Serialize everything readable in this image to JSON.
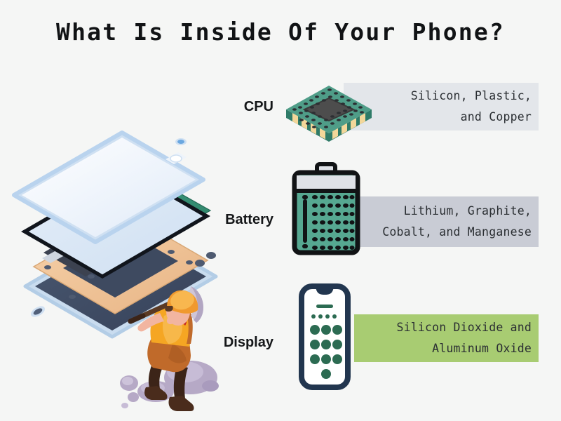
{
  "page": {
    "title": "What Is Inside Of Your Phone?",
    "background_color": "#f5f6f5"
  },
  "rows": [
    {
      "label": "CPU",
      "icon": "cpu-chip-icon",
      "band_color": "#e3e6ea",
      "materials_lines": [
        "Silicon, Plastic,",
        "and Copper"
      ],
      "materials_text": "Silicon, Plastic, and Copper"
    },
    {
      "label": "Battery",
      "icon": "battery-icon",
      "band_color": "#c9ccd5",
      "materials_lines": [
        "Lithium, Graphite,",
        "Cobalt, and Manganese"
      ],
      "materials_text": "Lithium, Graphite, Cobalt, and Manganese"
    },
    {
      "label": "Display",
      "icon": "phone-display-icon",
      "band_color": "#a8cc72",
      "materials_lines": [
        "Silicon Dioxide and",
        "Aluminum Oxide"
      ],
      "materials_text": "Silicon Dioxide and Aluminum Oxide"
    }
  ],
  "illustration": {
    "exploded_phone": "exploded-phone-diagram",
    "miner": "miner-with-pickaxe-illustration",
    "layers": [
      "glass-screen-layer",
      "display-frame-layer",
      "motherboard-pcb-layer",
      "battery-module-layer",
      "midframe-layer",
      "back-cover-layer"
    ]
  },
  "colors": {
    "title_text": "#111315",
    "label_text": "#151719",
    "material_text": "#2b2f33",
    "chip_teal": "#4f9d88",
    "chip_teal_dark": "#2f7b68",
    "chip_die": "#4d4d4d",
    "chip_pin": "#f3d79a",
    "battery_body": "#56a891",
    "battery_outline": "#111315",
    "battery_cap": "#dfe2e7",
    "phone_outline": "#22364f",
    "phone_dot": "#2c6b52",
    "glass_edge": "#b9d3ee",
    "pcb_green": "#2f8f72",
    "midframe_tan": "#f0c496",
    "back_navy": "#3d4a60",
    "miner_hat": "#f0992e",
    "miner_shirt": "#f5a623",
    "miner_pants": "#c06a2a",
    "miner_boot": "#4a2c1c",
    "rock": "#b3a7c4"
  }
}
